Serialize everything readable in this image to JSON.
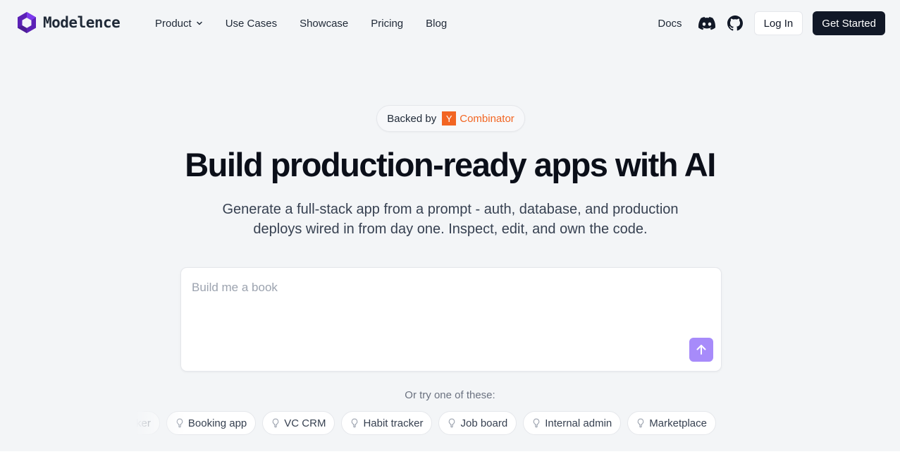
{
  "brand": {
    "name": "Modelence",
    "logo_icon": "hexagon-cube-logo",
    "accent": "#5b21b6"
  },
  "nav": {
    "items": [
      {
        "label": "Product",
        "has_dropdown": true
      },
      {
        "label": "Use Cases"
      },
      {
        "label": "Showcase"
      },
      {
        "label": "Pricing"
      },
      {
        "label": "Blog"
      }
    ]
  },
  "header_right": {
    "docs": "Docs",
    "discord_icon": "discord-icon",
    "github_icon": "github-icon",
    "login": "Log In",
    "get_started": "Get Started"
  },
  "hero": {
    "badge_prefix": "Backed by",
    "badge_logo": "Y",
    "badge_name": "Combinator",
    "badge_color": "#f26522",
    "headline": "Build production-ready apps with AI",
    "subheadline": "Generate a full-stack app from a prompt - auth, database, and production deploys wired in from day one. Inspect, edit, and own the code."
  },
  "prompt": {
    "placeholder": "Build me a book",
    "value": "",
    "send_icon": "arrow-up-icon",
    "send_color": "#a78bfa"
  },
  "suggestions": {
    "label": "Or try one of these:",
    "chip_icon": "lightbulb-icon",
    "chips": [
      "Issue tracker",
      "Booking app",
      "VC CRM",
      "Habit tracker",
      "Job board",
      "Internal admin",
      "Marketplace"
    ]
  }
}
